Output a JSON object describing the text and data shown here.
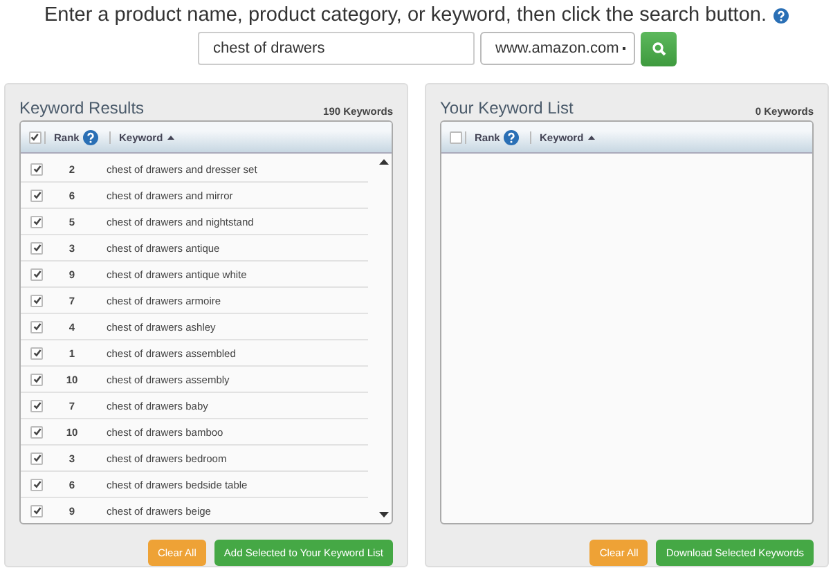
{
  "instruction": "Enter a product name, product category, or keyword, then click the search button.",
  "search": {
    "value": "chest of drawers",
    "site": "www.amazon.com"
  },
  "panels": [
    {
      "title": "Keyword Results",
      "count": "190 Keywords",
      "all_checked": true,
      "columns": [
        "Rank",
        "Keyword"
      ],
      "rows": [
        {
          "rank": "2",
          "keyword": "chest of drawers and dresser set",
          "checked": true
        },
        {
          "rank": "6",
          "keyword": "chest of drawers and mirror",
          "checked": true
        },
        {
          "rank": "5",
          "keyword": "chest of drawers and nightstand",
          "checked": true
        },
        {
          "rank": "3",
          "keyword": "chest of drawers antique",
          "checked": true
        },
        {
          "rank": "9",
          "keyword": "chest of drawers antique white",
          "checked": true
        },
        {
          "rank": "7",
          "keyword": "chest of drawers armoire",
          "checked": true
        },
        {
          "rank": "4",
          "keyword": "chest of drawers ashley",
          "checked": true
        },
        {
          "rank": "1",
          "keyword": "chest of drawers assembled",
          "checked": true
        },
        {
          "rank": "10",
          "keyword": "chest of drawers assembly",
          "checked": true
        },
        {
          "rank": "7",
          "keyword": "chest of drawers baby",
          "checked": true
        },
        {
          "rank": "10",
          "keyword": "chest of drawers bamboo",
          "checked": true
        },
        {
          "rank": "3",
          "keyword": "chest of drawers bedroom",
          "checked": true
        },
        {
          "rank": "6",
          "keyword": "chest of drawers bedside table",
          "checked": true
        },
        {
          "rank": "9",
          "keyword": "chest of drawers beige",
          "checked": true
        }
      ],
      "buttons": [
        {
          "label": "Clear All",
          "kind": "warning"
        },
        {
          "label": "Add Selected to Your Keyword List",
          "kind": "success"
        }
      ]
    },
    {
      "title": "Your Keyword List",
      "count": "0 Keywords",
      "all_checked": false,
      "columns": [
        "Rank",
        "Keyword"
      ],
      "buttons": [
        {
          "label": "Clear All",
          "kind": "warning"
        },
        {
          "label": "Download Selected Keywords",
          "kind": "success"
        }
      ]
    }
  ]
}
